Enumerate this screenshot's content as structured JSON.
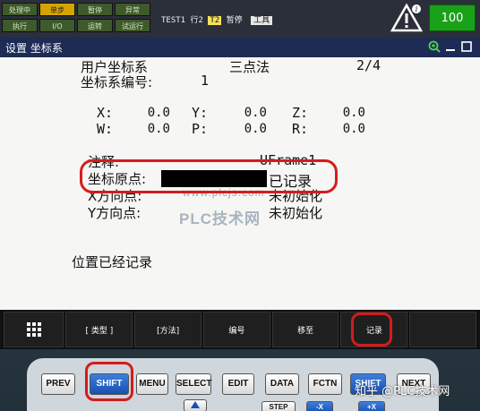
{
  "status": {
    "leds": [
      "处理中",
      "单步",
      "暂停",
      "异常",
      "执行",
      "I/O",
      "运转",
      "试运行"
    ],
    "program": "TEST1",
    "line": "行2",
    "tool": "T2",
    "state": "暂停",
    "mode": "工具",
    "override": "100"
  },
  "title": {
    "text": "设置 坐标系"
  },
  "screen": {
    "frame_type": "用户坐标系",
    "method": "三点法",
    "page": "2/4",
    "frame_no_label": "坐标系编号:",
    "frame_no": "1",
    "coord_labels": [
      "X:",
      "Y:",
      "Z:",
      "W:",
      "P:",
      "R:"
    ],
    "coord_values": [
      "0.0",
      "0.0",
      "0.0",
      "0.0",
      "0.0",
      "0.0"
    ],
    "comment_label": "注释:",
    "comment_value": "UFrame1",
    "origin_label": "坐标原点:",
    "origin_status": "已记录",
    "xdir_label": "X方向点:",
    "xdir_status": "未初始化",
    "ydir_label": "Y方向点:",
    "ydir_status": "未初始化",
    "message": "位置已经记录",
    "watermark_url": "www.plcjs.com",
    "watermark_brand": "PLC技术网"
  },
  "fkeys": {
    "menu_icon": "grid-icon",
    "f1": "[ 类型 ]",
    "f2": "[方法]",
    "f3": "编号",
    "f4": "移至",
    "f5": "记录",
    "f6": ""
  },
  "hardware": {
    "prev": "PREV",
    "shift": "SHIFT",
    "menu": "MENU",
    "select": "SELECT",
    "edit": "EDIT",
    "data": "DATA",
    "fctn": "FCTN",
    "shift2": "SHIFT",
    "next": "NEXT",
    "step": "STEP",
    "minus_x": "-X",
    "plus_x": "+X"
  },
  "zhihu_mark": "知乎 @PLC技术网",
  "colors": {
    "highlight": "#d41c1c",
    "title_bg": "#1d2b55",
    "override_bg": "#1aa11a"
  }
}
